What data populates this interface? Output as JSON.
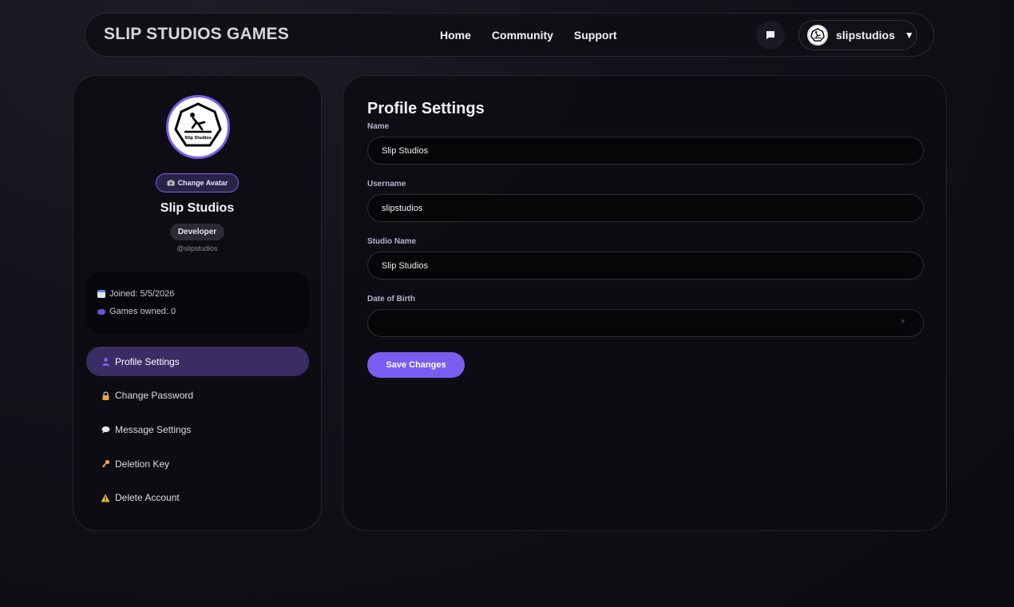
{
  "header": {
    "brand": "SLIP STUDIOS GAMES",
    "nav": [
      "Home",
      "Community",
      "Support"
    ],
    "user": {
      "name": "slipstudios",
      "caret": "▼"
    },
    "icons": {
      "messages": "chat-bubble-icon",
      "dropdown": "caret-down-icon"
    }
  },
  "sidebar": {
    "avatar_text": "Slip Studios",
    "change_avatar_label": "Change Avatar",
    "display_name": "Slip Studios",
    "role": "Developer",
    "handle": "@slipstudios",
    "stats": {
      "joined": "Joined: 5/5/2026",
      "games_owned": "Games owned: 0"
    },
    "menu": [
      {
        "label": "Profile Settings",
        "icon": "user-icon",
        "active": true
      },
      {
        "label": "Change Password",
        "icon": "lock-icon",
        "active": false
      },
      {
        "label": "Message Settings",
        "icon": "speech-bubble-icon",
        "active": false
      },
      {
        "label": "Deletion Key",
        "icon": "key-icon",
        "active": false
      },
      {
        "label": "Delete Account",
        "icon": "warning-icon",
        "active": false
      }
    ]
  },
  "main": {
    "title": "Profile Settings",
    "fields": [
      {
        "label": "Name",
        "value": "Slip Studios"
      },
      {
        "label": "Username",
        "value": "slipstudios"
      },
      {
        "label": "Studio Name",
        "value": "Slip Studios"
      },
      {
        "label": "Date of Birth",
        "value": ""
      }
    ],
    "save_label": "Save Changes"
  },
  "colors": {
    "accent": "#7b5cf0",
    "active_menu": "#3a2d63",
    "background": "#0e0e14"
  }
}
